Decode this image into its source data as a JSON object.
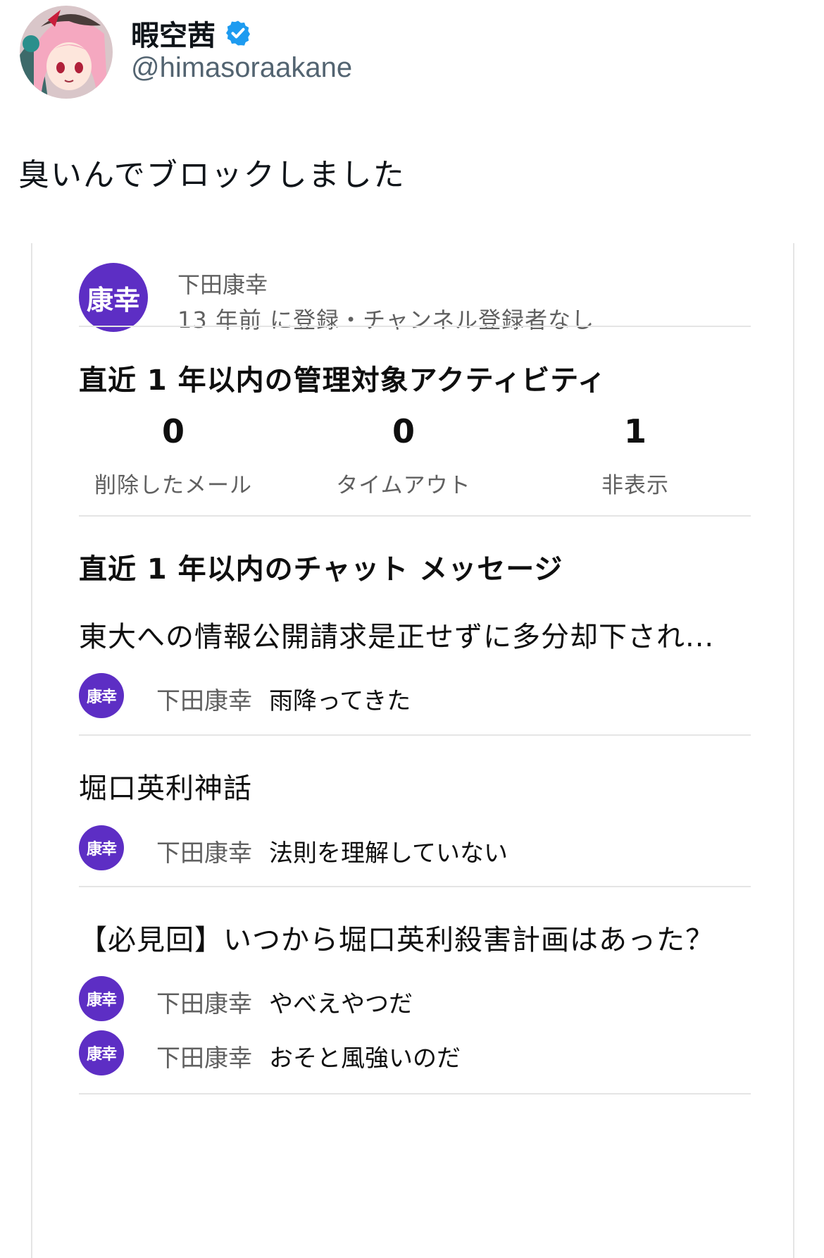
{
  "tweet": {
    "display_name": "暇空茜",
    "handle": "@himasoraakane",
    "text": "臭いんでブロックしました",
    "verified_icon": "verified-badge-icon",
    "colors": {
      "verified": "#1d9bf0"
    }
  },
  "card": {
    "channel_avatar_text": "康幸",
    "channel_name": "下田康幸",
    "channel_meta": "13 年前 に登録・チャンネル登録者なし",
    "activity_title": "直近 1 年以内の管理対象アクティビティ",
    "stats": [
      {
        "value": "0",
        "label": "削除したメール"
      },
      {
        "value": "0",
        "label": "タイムアウト"
      },
      {
        "value": "1",
        "label": "非表示"
      }
    ],
    "chat_title": "直近 1 年以内のチャット メッセージ",
    "videos": [
      {
        "title": "東大への情報公開請求是正せずに多分却下され...",
        "messages": [
          {
            "avatar_text": "康幸",
            "author": "下田康幸",
            "text": "雨降ってきた"
          }
        ]
      },
      {
        "title": "堀口英利神話",
        "messages": [
          {
            "avatar_text": "康幸",
            "author": "下田康幸",
            "text": "法則を理解していない"
          }
        ]
      },
      {
        "title": "【必見回】いつから堀口英利殺害計画はあった？",
        "messages": [
          {
            "avatar_text": "康幸",
            "author": "下田康幸",
            "text": "やべえやつだ"
          },
          {
            "avatar_text": "康幸",
            "author": "下田康幸",
            "text": "おそと風強いのだ"
          }
        ]
      }
    ],
    "colors": {
      "avatar_bg": "#5d2ec4"
    }
  }
}
